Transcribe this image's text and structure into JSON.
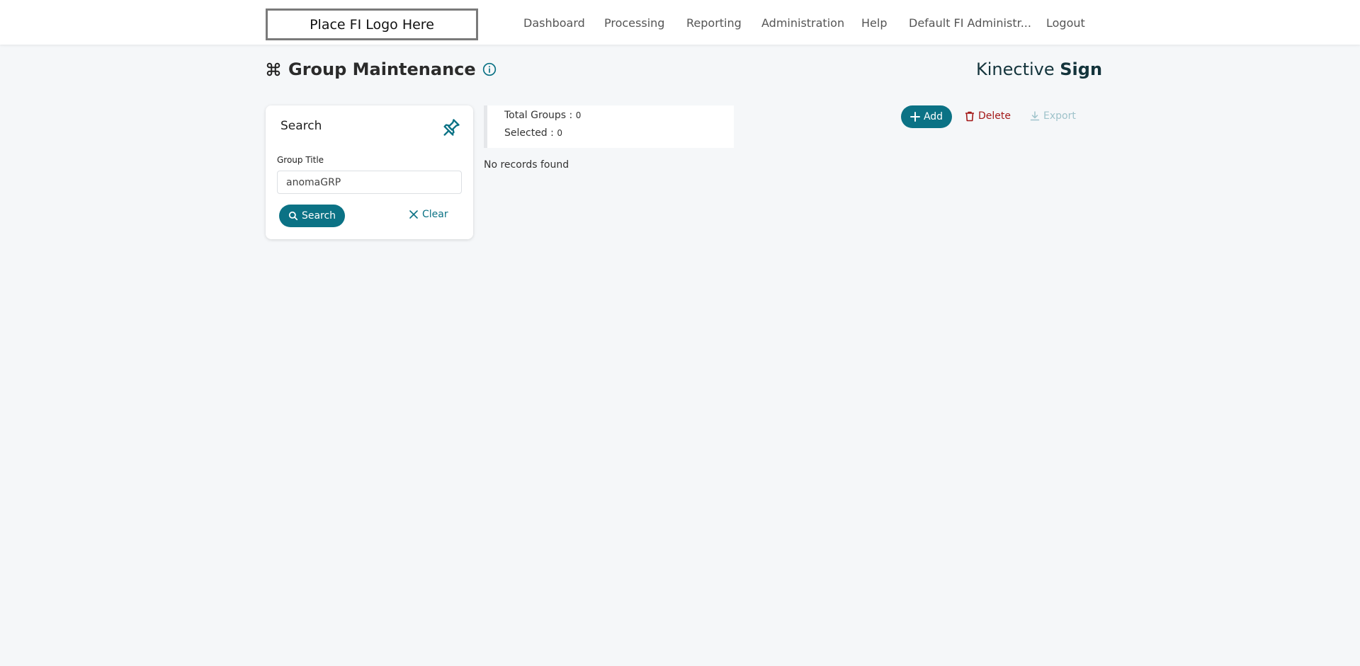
{
  "header": {
    "logo_text": "Place FI Logo Here",
    "nav": [
      {
        "label": "Dashboard"
      },
      {
        "label": "Processing"
      },
      {
        "label": "Reporting"
      },
      {
        "label": "Administration"
      },
      {
        "label": "Help"
      },
      {
        "label": "Default FI Administr..."
      },
      {
        "label": "Logout"
      }
    ]
  },
  "page": {
    "title": "Group Maintenance",
    "title_icon": "command-icon",
    "info_icon": "info-circle-icon",
    "brand_light": "Kinective",
    "brand_bold": "Sign"
  },
  "search_panel": {
    "title": "Search",
    "pin_icon": "pin-icon",
    "group_title_label": "Group Title",
    "group_title_value": "anomaGRP",
    "search_button": "Search",
    "clear_button": "Clear"
  },
  "summary": {
    "total_label": "Total Groups :",
    "total_value": "0",
    "selected_label": "Selected :",
    "selected_value": "0",
    "empty_message": "No records found"
  },
  "toolbar": {
    "add_label": "Add",
    "delete_label": "Delete",
    "export_label": "Export"
  },
  "colors": {
    "accent": "#0b7285",
    "danger": "#a31818",
    "disabled": "#9fc3cb",
    "background": "#f5f7f9"
  }
}
